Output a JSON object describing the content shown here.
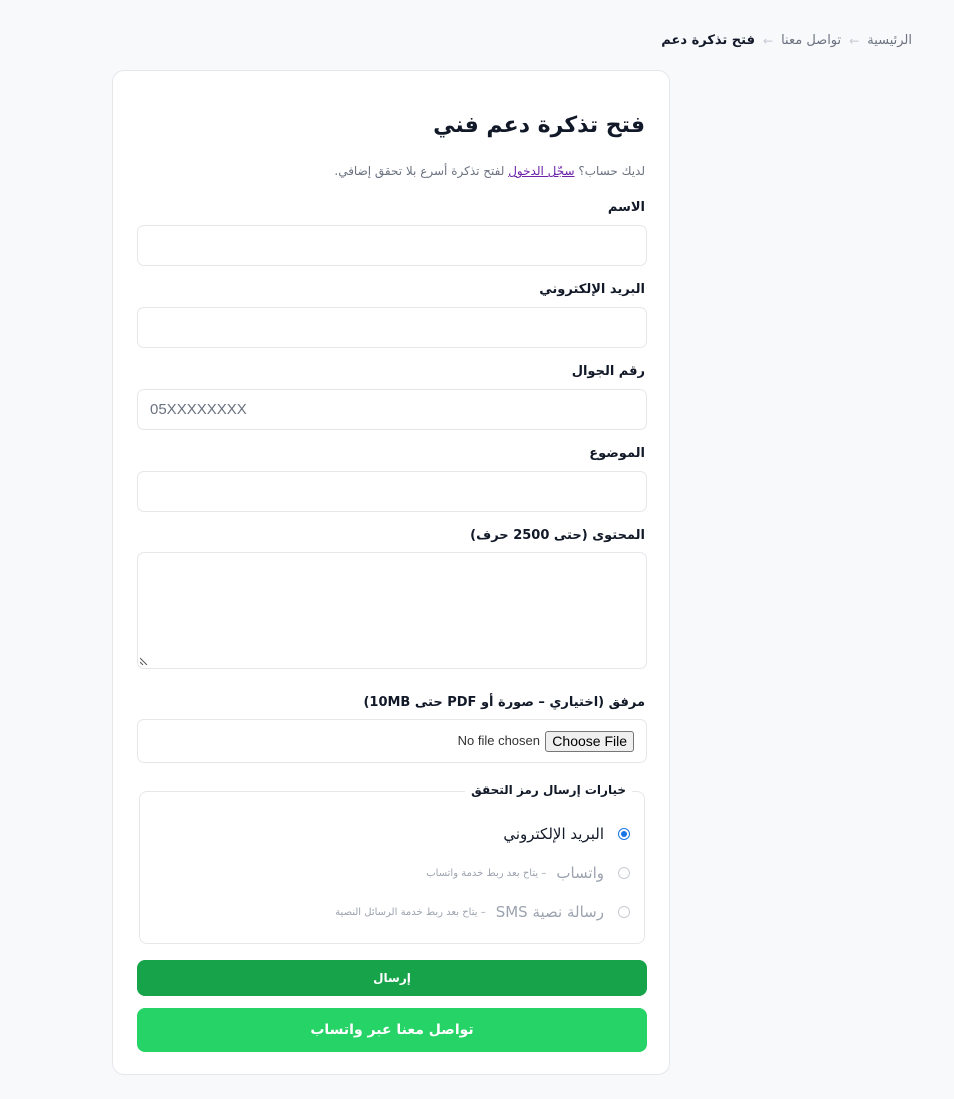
{
  "breadcrumb": {
    "home": "الرئيسية",
    "contact": "تواصل معنا",
    "current": "فتح تذكرة دعم",
    "separator": "←"
  },
  "form": {
    "title": "فتح تذكرة دعم فني",
    "login_hint_before": "لديك حساب؟ ",
    "login_link": "سجّل الدخول",
    "login_hint_after": " لفتح تذكرة أسرع بلا تحقق إضافي.",
    "name_label": "الاسم",
    "email_label": "البريد الإلكتروني",
    "phone_label": "رقم الجوال",
    "phone_placeholder": "05XXXXXXXX",
    "subject_label": "الموضوع",
    "content_label": "المحتوى (حتى 2500 حرف)",
    "attachment_label": "مرفق (اختياري – صورة أو PDF حتى 10MB)",
    "choose_file": "Choose File",
    "no_file": "No file chosen",
    "verification": {
      "legend": "خيارات إرسال رمز التحقق",
      "options": [
        {
          "label": "البريد الإلكتروني",
          "note": "",
          "checked": true,
          "disabled": false
        },
        {
          "label": "واتساب",
          "note": "– يتاح بعد ربط خدمة واتساب",
          "checked": false,
          "disabled": true
        },
        {
          "label": "رسالة نصية SMS",
          "note": "– يتاح بعد ربط خدمة الرسائل النصية",
          "checked": false,
          "disabled": true
        }
      ]
    },
    "submit_label": "إرسال",
    "whatsapp_label": "تواصل معنا عبر واتساب"
  },
  "colors": {
    "submit": "#16a34a",
    "whatsapp": "#25d366",
    "link": "#6b21a8",
    "radio_checked": "#1a73e8"
  }
}
